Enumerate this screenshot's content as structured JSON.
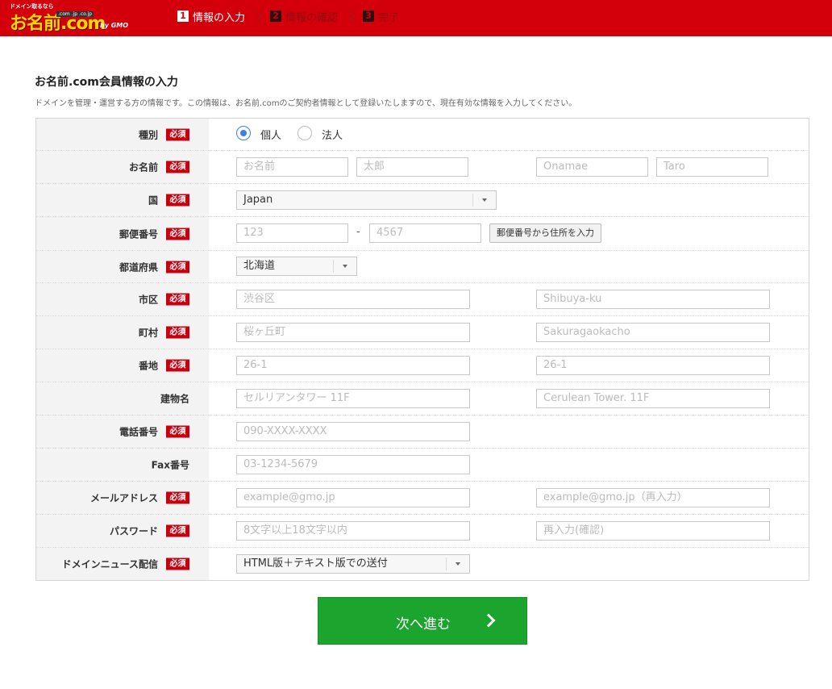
{
  "header": {
    "logo": {
      "tagline": "ドメイン取るなら",
      "main": "お名前.com",
      "tlds": ".com .jp .co.jp",
      "gmo": "by GMO"
    },
    "steps": [
      {
        "num": "1",
        "label": "情報の入力"
      },
      {
        "num": "2",
        "label": "情報の確認"
      },
      {
        "num": "3",
        "label": "完了"
      }
    ]
  },
  "section": {
    "title": "お名前.com会員情報の入力",
    "description": "ドメインを管理・運営する方の情報です。この情報は、お名前.comのご契約者情報として登録いたしますので、現在有効な情報を入力してください。"
  },
  "required_badge": "必須",
  "form": {
    "type": {
      "label": "種別",
      "options": [
        "個人",
        "法人"
      ],
      "selected": "個人"
    },
    "name": {
      "label": "お名前",
      "placeholders": [
        "お名前",
        "太郎",
        "Onamae",
        "Taro"
      ]
    },
    "country": {
      "label": "国",
      "value": "Japan"
    },
    "postal": {
      "label": "郵便番号",
      "placeholders": [
        "123",
        "4567"
      ],
      "separator": "-",
      "button": "郵便番号から住所を入力"
    },
    "prefecture": {
      "label": "都道府県",
      "value": "北海道"
    },
    "city": {
      "label": "市区",
      "placeholders": [
        "渋谷区",
        "Shibuya-ku"
      ]
    },
    "town": {
      "label": "町村",
      "placeholders": [
        "桜ヶ丘町",
        "Sakuragaokacho"
      ]
    },
    "street": {
      "label": "番地",
      "placeholders": [
        "26-1",
        "26-1"
      ]
    },
    "building": {
      "label": "建物名",
      "placeholders": [
        "セルリアンタワー 11F",
        "Cerulean Tower. 11F"
      ]
    },
    "phone": {
      "label": "電話番号",
      "placeholder": "090-XXXX-XXXX"
    },
    "fax": {
      "label": "Fax番号",
      "placeholder": "03-1234-5679"
    },
    "email": {
      "label": "メールアドレス",
      "placeholders": [
        "example@gmo.jp",
        "example@gmo.jp（再入力）"
      ]
    },
    "password": {
      "label": "パスワード",
      "placeholders": [
        "8文字以上18文字以内",
        "再入力(確認)"
      ]
    },
    "newsletter": {
      "label": "ドメインニュース配信",
      "value": "HTML版＋テキスト版での送付"
    }
  },
  "next_button": "次へ進む",
  "colors": {
    "brand_red": "#d3000b",
    "required_red": "#c70010",
    "next_green": "#1ca52e",
    "radio_blue": "#3b7ee8"
  }
}
